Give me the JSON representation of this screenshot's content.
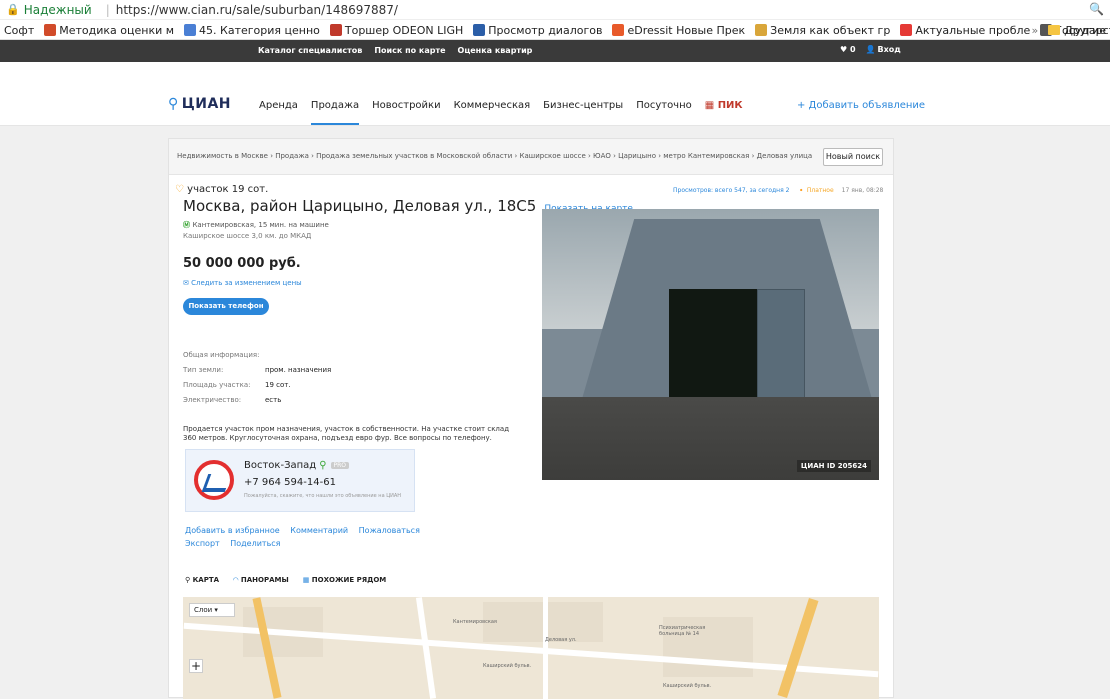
{
  "browser": {
    "secure_label": "Надежный",
    "url": "https://www.cian.ru/sale/suburban/148697887/",
    "bookmarks": [
      "Софт",
      "Методика оценки м",
      "45. Категория ценно",
      "Торшер ODEON LIGH",
      "Просмотр диалогов",
      "eDressit Новые Прек",
      "Земля как объект гр",
      "Актуальные пробле",
      "Государственная рег"
    ],
    "overflow": "»",
    "other_folder": "Другие"
  },
  "topnav": {
    "links": [
      "Каталог специалистов",
      "Поиск по карте",
      "Оценка квартир"
    ],
    "favorites": "♥ 0",
    "login": "Вход"
  },
  "header": {
    "logo": "ЦИАН",
    "nav": [
      "Аренда",
      "Продажа",
      "Новостройки",
      "Коммерческая",
      "Бизнес-центры",
      "Посуточно",
      "ПИК"
    ],
    "active_nav": "Продажа",
    "add_listing": "+ Добавить объявление"
  },
  "breadcrumbs": "Недвижимость в Москве › Продажа › Продажа земельных участков в Московской области › Каширское шоссе › ЮАО › Царицыно › метро Кантемировская › Деловая улица",
  "new_search": "Новый поиск",
  "listing": {
    "type": "участок 19 сот.",
    "address": "Москва, район Царицыно, Деловая ул., 18С5",
    "show_on_map": "Показать на карте",
    "metro": "Кантемировская, 15 мин. на машине",
    "highway": "Каширское шоссе 3,0 км. до МКАД",
    "price": "50 000 000 руб.",
    "follow_price": "Следить за изменением цены",
    "show_phone": "Показать телефон",
    "stats": "Просмотров: всего 547, за сегодня 2",
    "paid": "Платное",
    "date": "17 янв, 08:28"
  },
  "general_info": {
    "title": "Общая информация:",
    "rows": [
      {
        "label": "Тип земли:",
        "value": "пром. назначения"
      },
      {
        "label": "Площадь участка:",
        "value": "19 сот."
      },
      {
        "label": "Электричество:",
        "value": "есть"
      }
    ]
  },
  "description": "Продается участок пром назначения, участок в собственности. На участке стоит склад 360 метров. Круглосуточная охрана, подъезд евро фур. Все вопросы по телефону.",
  "agent": {
    "name": "Восток-Запад",
    "badge": "PRO",
    "phone": "+7 964 594-14-61",
    "note": "Пожалуйста, скажите, что нашли это объявление на ЦИАН"
  },
  "actions": {
    "row1": [
      "Добавить в избранное",
      "Комментарий",
      "Пожаловаться"
    ],
    "row2": [
      "Экспорт",
      "Поделиться"
    ]
  },
  "map_tabs": [
    "КАРТА",
    "ПАНОРАМЫ",
    "ПОХОЖИЕ РЯДОМ"
  ],
  "map": {
    "layers": "Слои",
    "plus": "+",
    "labels": [
      "Каширский бульв.",
      "Каширский бульв.",
      "Психиатрическая больница № 14",
      "Кантемировская",
      "Деловая ул."
    ]
  },
  "photo": {
    "watermark": "ЦИАН  ID 205624"
  }
}
